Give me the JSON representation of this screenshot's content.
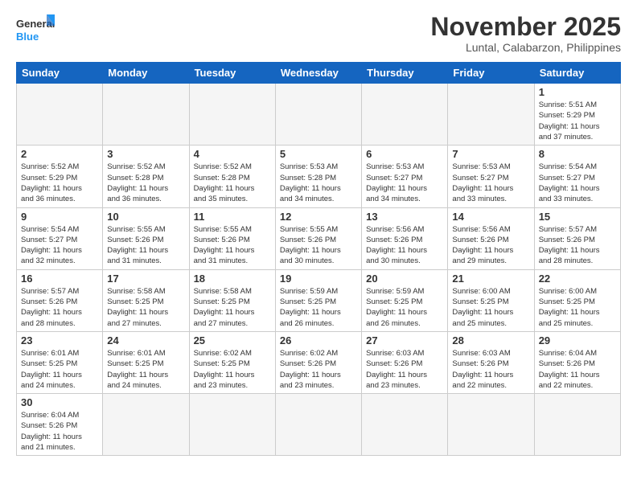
{
  "logo": {
    "line1": "General",
    "line2": "Blue"
  },
  "header": {
    "month": "November 2025",
    "location": "Luntal, Calabarzon, Philippines"
  },
  "weekdays": [
    "Sunday",
    "Monday",
    "Tuesday",
    "Wednesday",
    "Thursday",
    "Friday",
    "Saturday"
  ],
  "weeks": [
    [
      {
        "day": "",
        "info": ""
      },
      {
        "day": "",
        "info": ""
      },
      {
        "day": "",
        "info": ""
      },
      {
        "day": "",
        "info": ""
      },
      {
        "day": "",
        "info": ""
      },
      {
        "day": "",
        "info": ""
      },
      {
        "day": "1",
        "info": "Sunrise: 5:51 AM\nSunset: 5:29 PM\nDaylight: 11 hours\nand 37 minutes."
      }
    ],
    [
      {
        "day": "2",
        "info": "Sunrise: 5:52 AM\nSunset: 5:29 PM\nDaylight: 11 hours\nand 36 minutes."
      },
      {
        "day": "3",
        "info": "Sunrise: 5:52 AM\nSunset: 5:28 PM\nDaylight: 11 hours\nand 36 minutes."
      },
      {
        "day": "4",
        "info": "Sunrise: 5:52 AM\nSunset: 5:28 PM\nDaylight: 11 hours\nand 35 minutes."
      },
      {
        "day": "5",
        "info": "Sunrise: 5:53 AM\nSunset: 5:28 PM\nDaylight: 11 hours\nand 34 minutes."
      },
      {
        "day": "6",
        "info": "Sunrise: 5:53 AM\nSunset: 5:27 PM\nDaylight: 11 hours\nand 34 minutes."
      },
      {
        "day": "7",
        "info": "Sunrise: 5:53 AM\nSunset: 5:27 PM\nDaylight: 11 hours\nand 33 minutes."
      },
      {
        "day": "8",
        "info": "Sunrise: 5:54 AM\nSunset: 5:27 PM\nDaylight: 11 hours\nand 33 minutes."
      }
    ],
    [
      {
        "day": "9",
        "info": "Sunrise: 5:54 AM\nSunset: 5:27 PM\nDaylight: 11 hours\nand 32 minutes."
      },
      {
        "day": "10",
        "info": "Sunrise: 5:55 AM\nSunset: 5:26 PM\nDaylight: 11 hours\nand 31 minutes."
      },
      {
        "day": "11",
        "info": "Sunrise: 5:55 AM\nSunset: 5:26 PM\nDaylight: 11 hours\nand 31 minutes."
      },
      {
        "day": "12",
        "info": "Sunrise: 5:55 AM\nSunset: 5:26 PM\nDaylight: 11 hours\nand 30 minutes."
      },
      {
        "day": "13",
        "info": "Sunrise: 5:56 AM\nSunset: 5:26 PM\nDaylight: 11 hours\nand 30 minutes."
      },
      {
        "day": "14",
        "info": "Sunrise: 5:56 AM\nSunset: 5:26 PM\nDaylight: 11 hours\nand 29 minutes."
      },
      {
        "day": "15",
        "info": "Sunrise: 5:57 AM\nSunset: 5:26 PM\nDaylight: 11 hours\nand 28 minutes."
      }
    ],
    [
      {
        "day": "16",
        "info": "Sunrise: 5:57 AM\nSunset: 5:26 PM\nDaylight: 11 hours\nand 28 minutes."
      },
      {
        "day": "17",
        "info": "Sunrise: 5:58 AM\nSunset: 5:25 PM\nDaylight: 11 hours\nand 27 minutes."
      },
      {
        "day": "18",
        "info": "Sunrise: 5:58 AM\nSunset: 5:25 PM\nDaylight: 11 hours\nand 27 minutes."
      },
      {
        "day": "19",
        "info": "Sunrise: 5:59 AM\nSunset: 5:25 PM\nDaylight: 11 hours\nand 26 minutes."
      },
      {
        "day": "20",
        "info": "Sunrise: 5:59 AM\nSunset: 5:25 PM\nDaylight: 11 hours\nand 26 minutes."
      },
      {
        "day": "21",
        "info": "Sunrise: 6:00 AM\nSunset: 5:25 PM\nDaylight: 11 hours\nand 25 minutes."
      },
      {
        "day": "22",
        "info": "Sunrise: 6:00 AM\nSunset: 5:25 PM\nDaylight: 11 hours\nand 25 minutes."
      }
    ],
    [
      {
        "day": "23",
        "info": "Sunrise: 6:01 AM\nSunset: 5:25 PM\nDaylight: 11 hours\nand 24 minutes."
      },
      {
        "day": "24",
        "info": "Sunrise: 6:01 AM\nSunset: 5:25 PM\nDaylight: 11 hours\nand 24 minutes."
      },
      {
        "day": "25",
        "info": "Sunrise: 6:02 AM\nSunset: 5:25 PM\nDaylight: 11 hours\nand 23 minutes."
      },
      {
        "day": "26",
        "info": "Sunrise: 6:02 AM\nSunset: 5:26 PM\nDaylight: 11 hours\nand 23 minutes."
      },
      {
        "day": "27",
        "info": "Sunrise: 6:03 AM\nSunset: 5:26 PM\nDaylight: 11 hours\nand 23 minutes."
      },
      {
        "day": "28",
        "info": "Sunrise: 6:03 AM\nSunset: 5:26 PM\nDaylight: 11 hours\nand 22 minutes."
      },
      {
        "day": "29",
        "info": "Sunrise: 6:04 AM\nSunset: 5:26 PM\nDaylight: 11 hours\nand 22 minutes."
      }
    ],
    [
      {
        "day": "30",
        "info": "Sunrise: 6:04 AM\nSunset: 5:26 PM\nDaylight: 11 hours\nand 21 minutes."
      },
      {
        "day": "",
        "info": ""
      },
      {
        "day": "",
        "info": ""
      },
      {
        "day": "",
        "info": ""
      },
      {
        "day": "",
        "info": ""
      },
      {
        "day": "",
        "info": ""
      },
      {
        "day": "",
        "info": ""
      }
    ]
  ]
}
